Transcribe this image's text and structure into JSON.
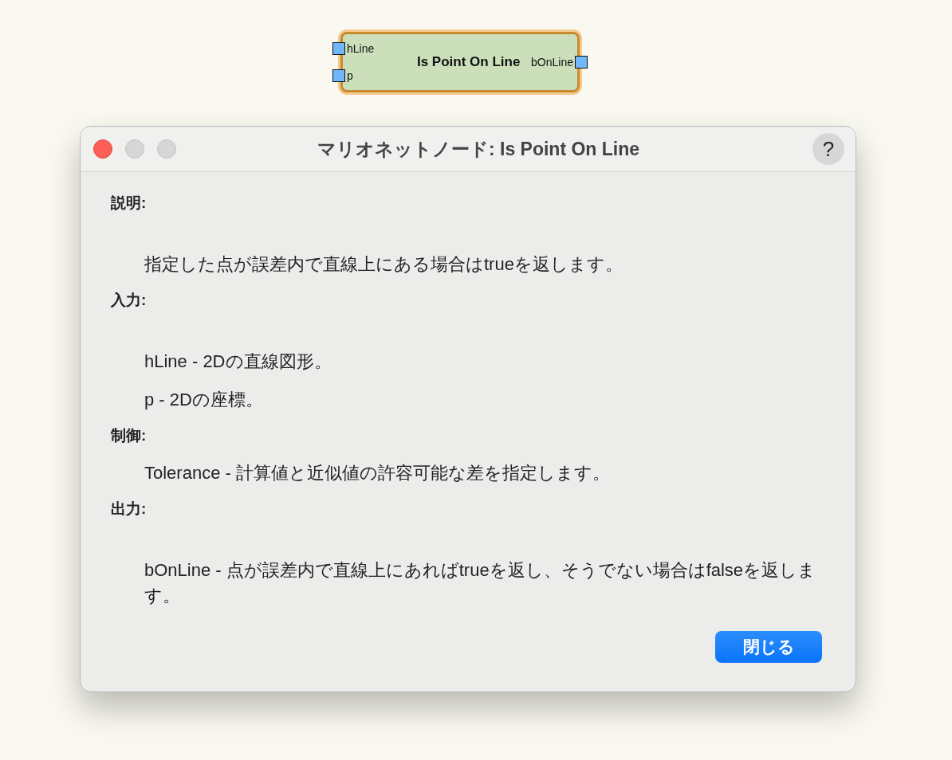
{
  "node": {
    "title": "Is Point On Line",
    "inputs": [
      "hLine",
      "p"
    ],
    "outputs": [
      "bOnLine"
    ]
  },
  "dialog": {
    "title": "マリオネットノード: Is Point On Line",
    "help": "?",
    "sections": [
      {
        "heading": "説明:",
        "items": [
          "指定した点が誤差内で直線上にある場合はtrueを返します。"
        ]
      },
      {
        "heading": "入力:",
        "items": [
          "hLine - 2Dの直線図形。",
          "p - 2Dの座標。"
        ]
      },
      {
        "heading": "制御:",
        "items": [
          "Tolerance - 計算値と近似値の許容可能な差を指定します。"
        ]
      },
      {
        "heading": "出力:",
        "items": [
          "bOnLine - 点が誤差内で直線上にあればtrueを返し、そうでない場合はfalseを返します。"
        ]
      }
    ],
    "button": "閉じる"
  }
}
